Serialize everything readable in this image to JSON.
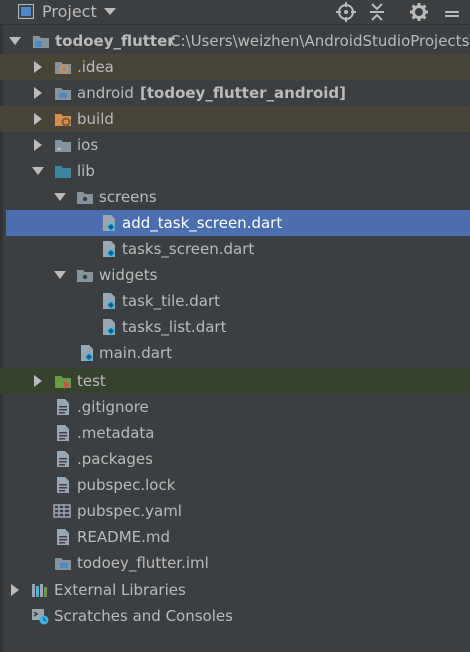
{
  "header": {
    "title": "Project",
    "icons": [
      "project-view-icon",
      "dropdown-icon",
      "locate-icon",
      "collapse-icon",
      "settings-icon",
      "hide-icon"
    ]
  },
  "tree": {
    "root": {
      "name": "todoey_flutter",
      "path": "C:\\Users\\weizhen\\AndroidStudioProjects\\"
    },
    "items": [
      {
        "label": ".idea"
      },
      {
        "label": "android",
        "module": "[todoey_flutter_android]"
      },
      {
        "label": "build"
      },
      {
        "label": "ios"
      },
      {
        "label": "lib"
      },
      {
        "label": "screens"
      },
      {
        "label": "add_task_screen.dart"
      },
      {
        "label": "tasks_screen.dart"
      },
      {
        "label": "widgets"
      },
      {
        "label": "task_tile.dart"
      },
      {
        "label": "tasks_list.dart"
      },
      {
        "label": "main.dart"
      },
      {
        "label": "test"
      },
      {
        "label": ".gitignore"
      },
      {
        "label": ".metadata"
      },
      {
        "label": ".packages"
      },
      {
        "label": "pubspec.lock"
      },
      {
        "label": "pubspec.yaml"
      },
      {
        "label": "README.md"
      },
      {
        "label": "todoey_flutter.iml"
      }
    ],
    "external_libraries": "External Libraries",
    "scratches": "Scratches and Consoles"
  },
  "colors": {
    "background": "#3c3f41",
    "selection": "#4b6eaf",
    "excluded_folder_bg": "#49443a",
    "test_folder_bg": "#36412e",
    "folder": "#87939a",
    "source_folder": "#3e86a0",
    "excluded_folder": "#d18f52",
    "test_folder": "#6a9b47",
    "text": "#bbbbbb"
  }
}
